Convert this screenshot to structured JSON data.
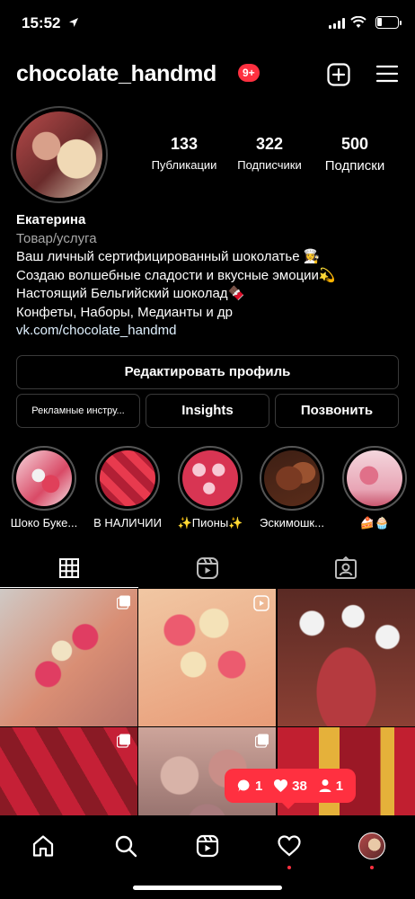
{
  "status_bar": {
    "time": "15:52"
  },
  "header": {
    "username": "chocolate_handmd",
    "notification_badge": "9+"
  },
  "stats": [
    {
      "number": "133",
      "label": "Публикации"
    },
    {
      "number": "322",
      "label": "Подписчики"
    },
    {
      "number": "500",
      "label": "Подписки"
    }
  ],
  "bio": {
    "name": "Екатерина",
    "category": "Товар/услуга",
    "lines": [
      "Ваш личный сертифицированный шоколатье 👩‍🍳",
      "Создаю волшебные сладости и вкусные эмоции💫",
      "Настоящий Бельгийский шоколад🍫",
      "Конфеты, Наборы, Медианты и др"
    ],
    "link": "vk.com/chocolate_handmd"
  },
  "buttons": {
    "edit_profile": "Редактировать профиль",
    "ads_tools": "Рекламные инстру...",
    "insights": "Insights",
    "call": "Позвонить"
  },
  "highlights": [
    {
      "label": "Шоко Буке..."
    },
    {
      "label": "В НАЛИЧИИ"
    },
    {
      "label": "✨Пионы✨"
    },
    {
      "label": "Эскимошк..."
    },
    {
      "label": "🍰🧁"
    }
  ],
  "notification": {
    "comments": "1",
    "likes": "38",
    "followers": "1"
  },
  "colors": {
    "background": "#000000",
    "accent": "#ff3040",
    "link": "#e0f1ff",
    "secondary_text": "#a8a8a8"
  }
}
